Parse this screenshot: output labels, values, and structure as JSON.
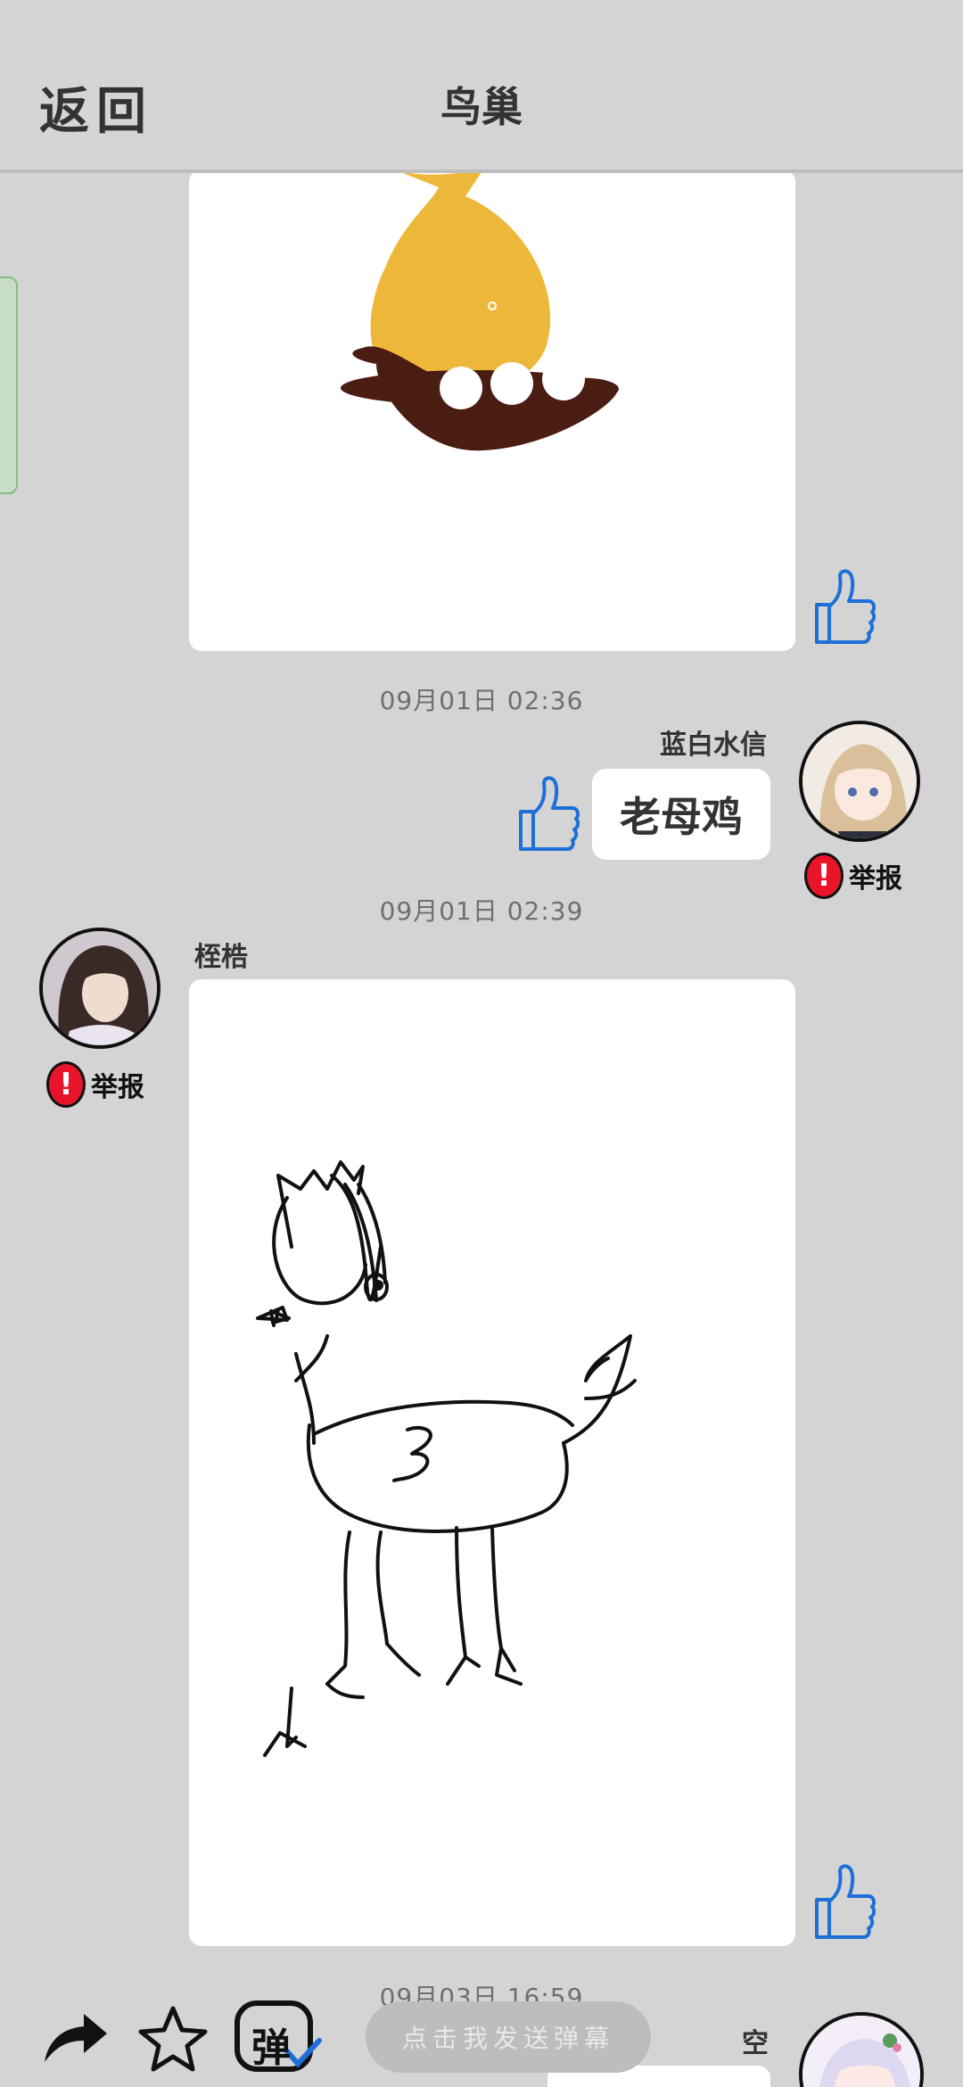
{
  "header": {
    "back_label": "返回",
    "title": "鸟巢"
  },
  "messages": {
    "m1": {},
    "m2": {
      "timestamp": "09月01日  02:36",
      "username": "蓝白水信",
      "text": "老母鸡",
      "report_label": "举报"
    },
    "m3": {
      "timestamp": "09月01日  02:39",
      "username": "桎梏",
      "report_label": "举报"
    },
    "m4": {
      "timestamp": "09月03日  16:59",
      "username": "空"
    }
  },
  "bottom_bar": {
    "danmu_placeholder": "点击我发送弹幕",
    "danmu_icon_char": "弹"
  },
  "colors": {
    "background": "#d4d4d4",
    "report_red": "#e8142a",
    "like_blue": "#1e6fd8"
  }
}
